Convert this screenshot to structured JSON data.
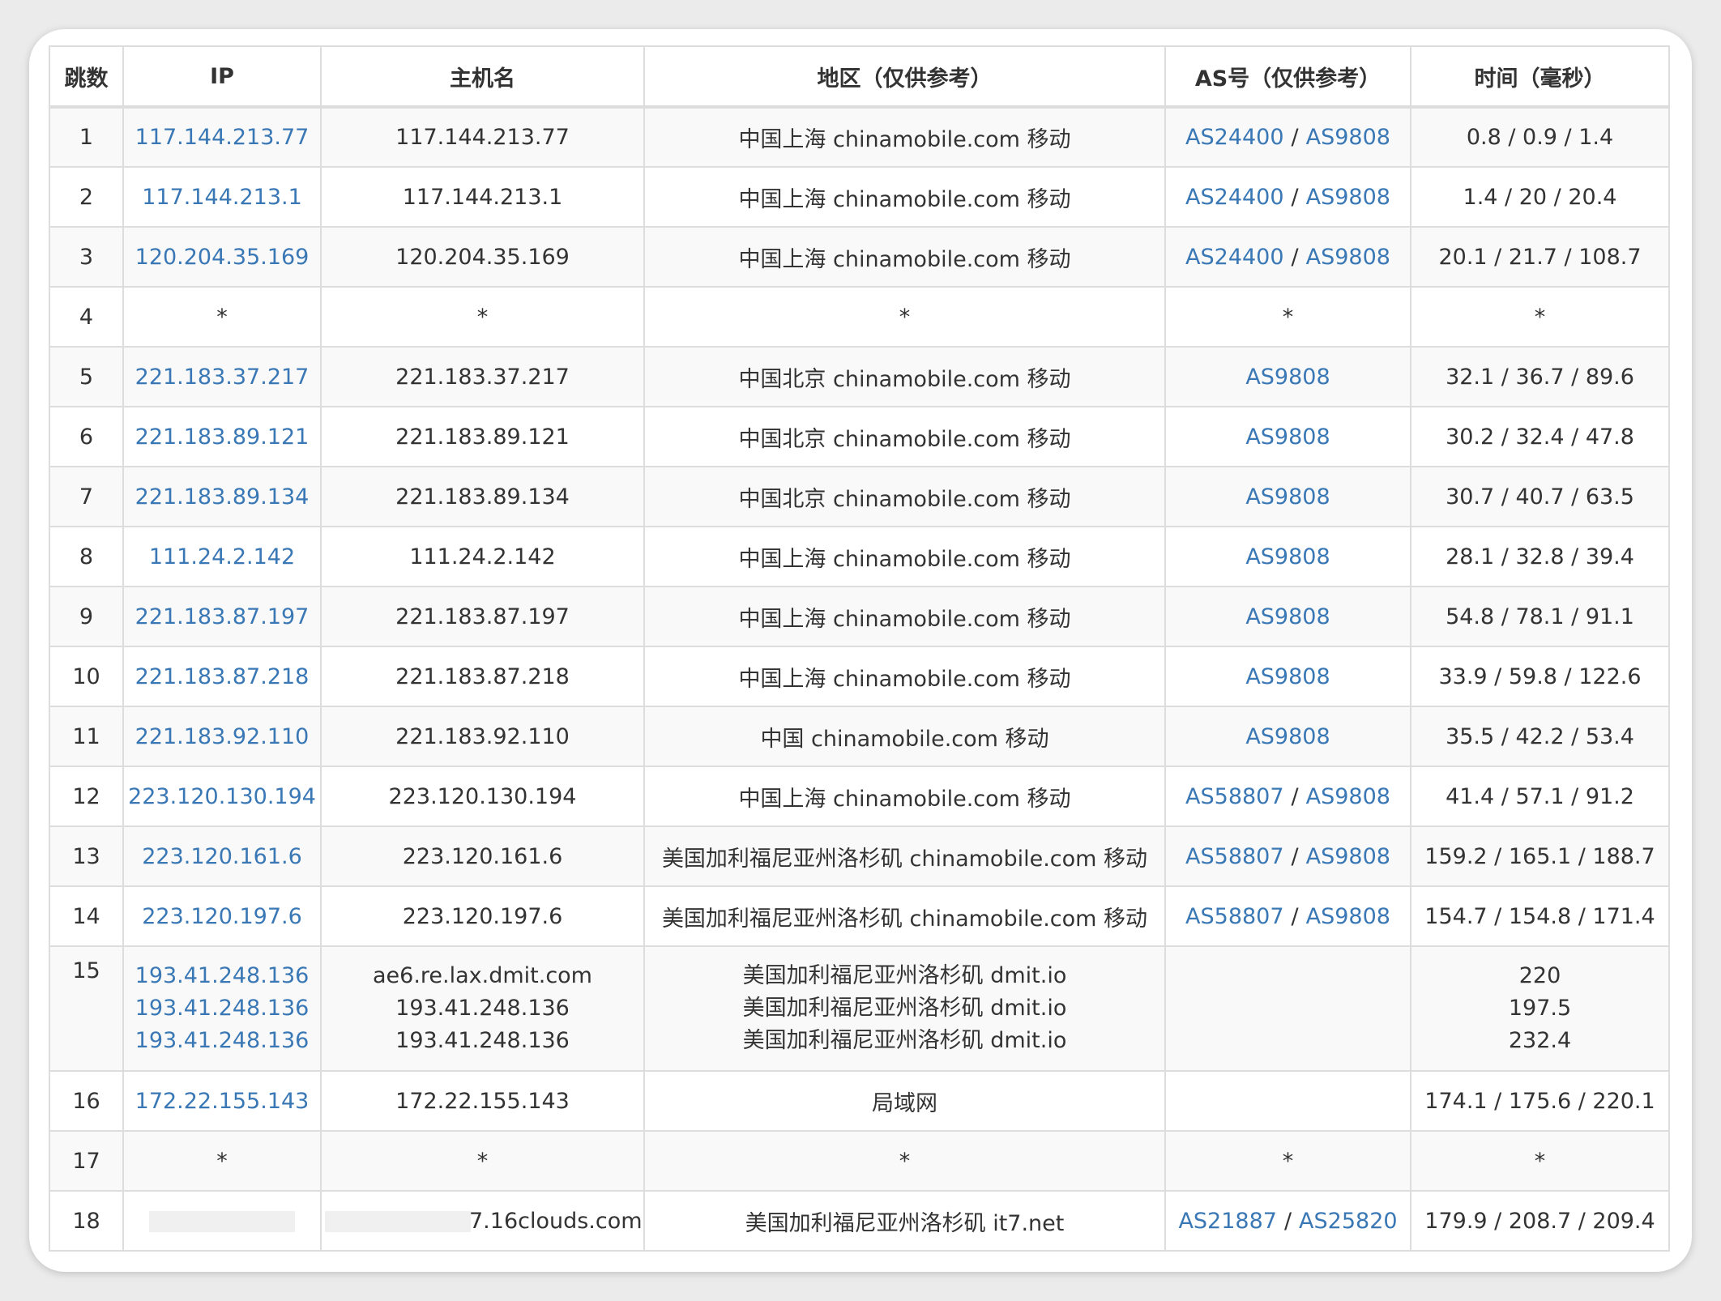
{
  "headers": {
    "hop": "跳数",
    "ip": "IP",
    "hostname": "主机名",
    "region": "地区（仅供参考）",
    "asn": "AS号（仅供参考）",
    "time": "时间（毫秒）"
  },
  "rows": [
    {
      "hop": "1",
      "ip": "117.144.213.77",
      "hostname": "117.144.213.77",
      "region": "中国上海 chinamobile.com 移动",
      "as1": "AS24400",
      "as2": "AS9808",
      "time": "0.8 / 0.9 / 1.4"
    },
    {
      "hop": "2",
      "ip": "117.144.213.1",
      "hostname": "117.144.213.1",
      "region": "中国上海 chinamobile.com 移动",
      "as1": "AS24400",
      "as2": "AS9808",
      "time": "1.4 / 20 / 20.4"
    },
    {
      "hop": "3",
      "ip": "120.204.35.169",
      "hostname": "120.204.35.169",
      "region": "中国上海 chinamobile.com 移动",
      "as1": "AS24400",
      "as2": "AS9808",
      "time": "20.1 / 21.7 / 108.7"
    },
    {
      "hop": "4",
      "ip": "*",
      "hostname": "*",
      "region": "*",
      "as": "*",
      "time": "*"
    },
    {
      "hop": "5",
      "ip": "221.183.37.217",
      "hostname": "221.183.37.217",
      "region": "中国北京 chinamobile.com 移动",
      "as": "AS9808",
      "time": "32.1 / 36.7 / 89.6"
    },
    {
      "hop": "6",
      "ip": "221.183.89.121",
      "hostname": "221.183.89.121",
      "region": "中国北京 chinamobile.com 移动",
      "as": "AS9808",
      "time": "30.2 / 32.4 / 47.8"
    },
    {
      "hop": "7",
      "ip": "221.183.89.134",
      "hostname": "221.183.89.134",
      "region": "中国北京 chinamobile.com 移动",
      "as": "AS9808",
      "time": "30.7 / 40.7 / 63.5"
    },
    {
      "hop": "8",
      "ip": "111.24.2.142",
      "hostname": "111.24.2.142",
      "region": "中国上海 chinamobile.com 移动",
      "as": "AS9808",
      "time": "28.1 / 32.8 / 39.4"
    },
    {
      "hop": "9",
      "ip": "221.183.87.197",
      "hostname": "221.183.87.197",
      "region": "中国上海 chinamobile.com 移动",
      "as": "AS9808",
      "time": "54.8 / 78.1 / 91.1"
    },
    {
      "hop": "10",
      "ip": "221.183.87.218",
      "hostname": "221.183.87.218",
      "region": "中国上海 chinamobile.com 移动",
      "as": "AS9808",
      "time": "33.9 / 59.8 / 122.6"
    },
    {
      "hop": "11",
      "ip": "221.183.92.110",
      "hostname": "221.183.92.110",
      "region": "中国 chinamobile.com 移动",
      "as": "AS9808",
      "time": "35.5 / 42.2 / 53.4"
    },
    {
      "hop": "12",
      "ip": "223.120.130.194",
      "hostname": "223.120.130.194",
      "region": "中国上海 chinamobile.com 移动",
      "as1": "AS58807",
      "as2": "AS9808",
      "time": "41.4 / 57.1 / 91.2"
    },
    {
      "hop": "13",
      "ip": "223.120.161.6",
      "hostname": "223.120.161.6",
      "region": "美国加利福尼亚州洛杉矶 chinamobile.com 移动",
      "as1": "AS58807",
      "as2": "AS9808",
      "time": "159.2 / 165.1 / 188.7"
    },
    {
      "hop": "14",
      "ip": "223.120.197.6",
      "hostname": "223.120.197.6",
      "region": "美国加利福尼亚州洛杉矶 chinamobile.com 移动",
      "as1": "AS58807",
      "as2": "AS9808",
      "time": "154.7 / 154.8 / 171.4"
    },
    {
      "hop": "15",
      "ips": [
        "193.41.248.136",
        "193.41.248.136",
        "193.41.248.136"
      ],
      "hostnames": [
        "ae6.re.lax.dmit.com",
        "193.41.248.136",
        "193.41.248.136"
      ],
      "regions": [
        "美国加利福尼亚州洛杉矶 dmit.io",
        "美国加利福尼亚州洛杉矶 dmit.io",
        "美国加利福尼亚州洛杉矶 dmit.io"
      ],
      "as": "",
      "times": [
        "220",
        "197.5",
        "232.4"
      ]
    },
    {
      "hop": "16",
      "ip": "172.22.155.143",
      "hostname": "172.22.155.143",
      "region": "局域网",
      "as": "",
      "time": "174.1 / 175.6 / 220.1"
    },
    {
      "hop": "17",
      "ip": "*",
      "hostname": "*",
      "region": "*",
      "as": "*",
      "time": "*"
    },
    {
      "hop": "18",
      "ip": "",
      "hostname_suffix": "7.16clouds.com",
      "region": "美国加利福尼亚州洛杉矶 it7.net",
      "as1": "AS21887",
      "as2": "AS25820",
      "time": "179.9 / 208.7 / 209.4"
    }
  ],
  "separator": "/",
  "colors": {
    "link": "#3a78b5",
    "text": "#333333",
    "border": "#dddddd",
    "stripe": "#f9f9f9"
  }
}
